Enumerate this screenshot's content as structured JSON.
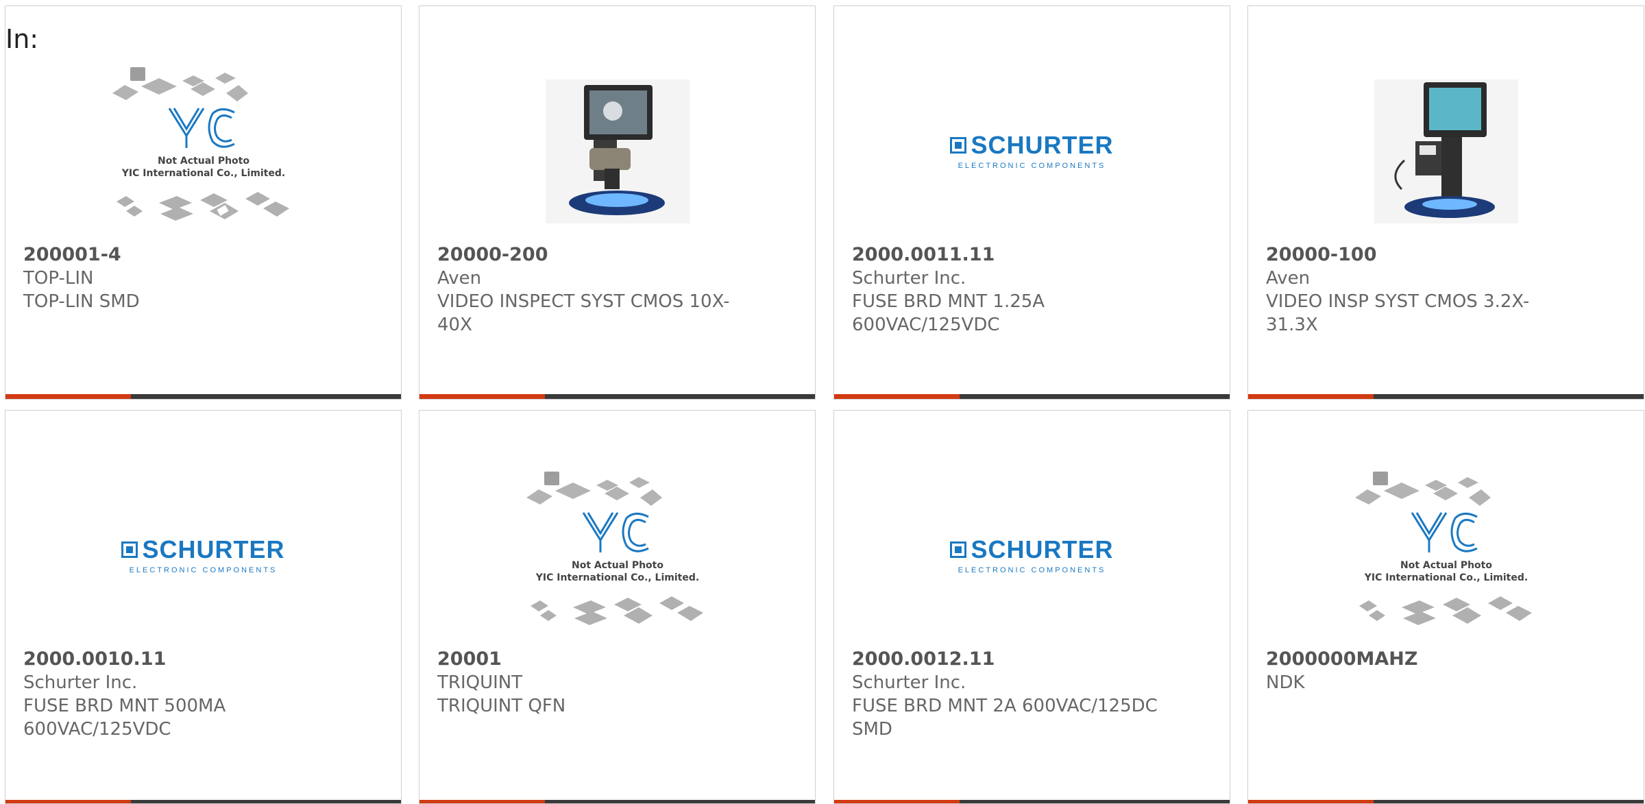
{
  "header": {
    "label": "In:"
  },
  "placeholder": {
    "line1": "Not Actual Photo",
    "line2": "YIC International Co., Limited.",
    "logo_text": "YIC"
  },
  "schurter_logo": {
    "word": "SCHURTER",
    "tagline": "ELECTRONIC COMPONENTS"
  },
  "colors": {
    "accent": "#d23a12",
    "bar": "#3a3a3a",
    "brand_blue": "#1a78c2"
  },
  "products": [
    {
      "part_number": "200001-4",
      "manufacturer": "TOP-LIN",
      "description": "TOP-LIN SMD",
      "image": "yic-placeholder"
    },
    {
      "part_number": "20000-200",
      "manufacturer": "Aven",
      "description": "VIDEO INSPECT SYST CMOS 10X-40X",
      "image": "video-inspection-system"
    },
    {
      "part_number": "2000.0011.11",
      "manufacturer": "Schurter Inc.",
      "description": "FUSE BRD MNT 1.25A 600VAC/125VDC",
      "image": "schurter-logo"
    },
    {
      "part_number": "20000-100",
      "manufacturer": "Aven",
      "description": "VIDEO INSP SYST CMOS 3.2X-31.3X",
      "image": "video-inspection-system"
    },
    {
      "part_number": "2000.0010.11",
      "manufacturer": "Schurter Inc.",
      "description": "FUSE BRD MNT 500MA 600VAC/125VDC",
      "image": "schurter-logo"
    },
    {
      "part_number": "20001",
      "manufacturer": "TRIQUINT",
      "description": "TRIQUINT QFN",
      "image": "yic-placeholder"
    },
    {
      "part_number": "2000.0012.11",
      "manufacturer": "Schurter Inc.",
      "description": "FUSE BRD MNT 2A 600VAC/125DC SMD",
      "image": "schurter-logo"
    },
    {
      "part_number": "2000000MAHZ",
      "manufacturer": "NDK",
      "description": "",
      "image": "yic-placeholder"
    }
  ]
}
